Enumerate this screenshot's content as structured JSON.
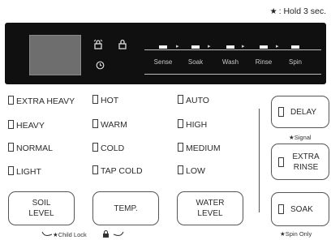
{
  "hint": {
    "star": "★",
    "text": ": Hold 3 sec."
  },
  "display": {
    "icons": {
      "lock": "lock-icon",
      "child_lock": "child-lock-icon",
      "clock": "clock-icon"
    },
    "stages": [
      "Sense",
      "Soak",
      "Wash",
      "Rinse",
      "Spin"
    ],
    "arrow": "▸"
  },
  "soil": [
    "EXTRA HEAVY",
    "HEAVY",
    "NORMAL",
    "LIGHT"
  ],
  "temp": [
    "HOT",
    "WARM",
    "COLD",
    "TAP COLD"
  ],
  "water": [
    "AUTO",
    "HIGH",
    "MEDIUM",
    "LOW"
  ],
  "buttons": {
    "soil": "SOIL LEVEL",
    "temp": "TEMP.",
    "water": "WATER LEVEL",
    "delay": "DELAY",
    "extra_rinse": "EXTRA RINSE",
    "soak": "SOAK"
  },
  "notes": {
    "signal": "★Signal",
    "spin_only": "★Spin Only",
    "child_lock": "★Child Lock"
  }
}
